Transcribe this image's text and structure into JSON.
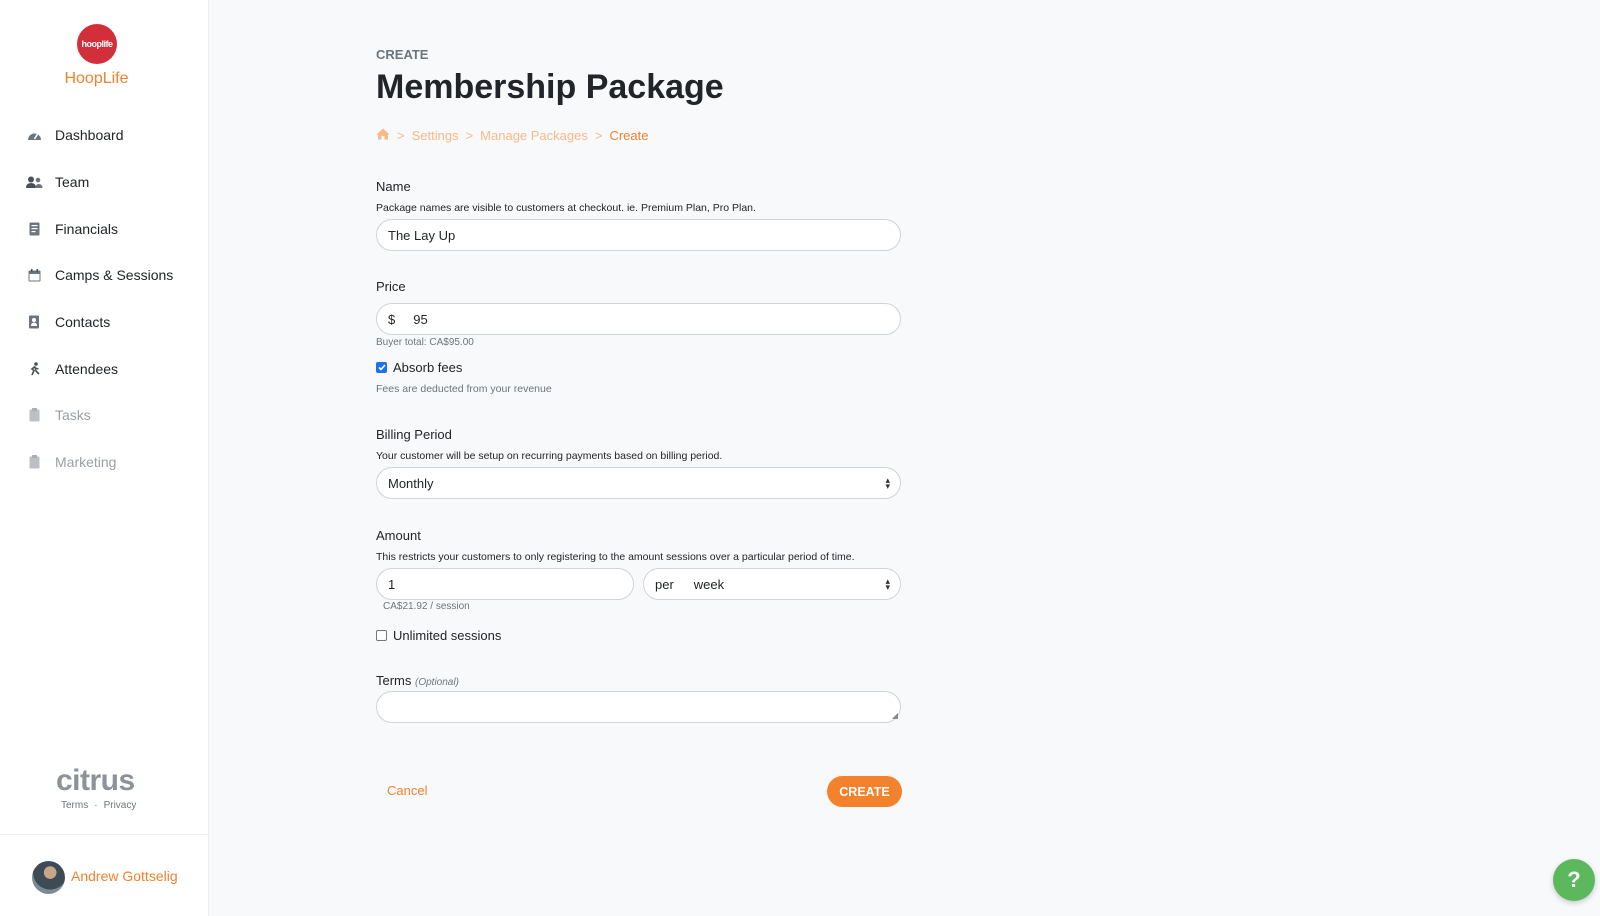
{
  "brand": {
    "logo_text": "hooplife",
    "name": "HoopLife",
    "accent": "#f4812b",
    "logo_color": "#d32f3a"
  },
  "sidebar": {
    "items": [
      {
        "label": "Dashboard",
        "icon": "gauge-icon",
        "disabled": false
      },
      {
        "label": "Team",
        "icon": "users-icon",
        "disabled": false
      },
      {
        "label": "Financials",
        "icon": "receipt-icon",
        "disabled": false
      },
      {
        "label": "Camps & Sessions",
        "icon": "calendar-icon",
        "disabled": false
      },
      {
        "label": "Contacts",
        "icon": "address-book-icon",
        "disabled": false
      },
      {
        "label": "Attendees",
        "icon": "running-icon",
        "disabled": false
      },
      {
        "label": "Tasks",
        "icon": "clipboard-icon",
        "disabled": true
      },
      {
        "label": "Marketing",
        "icon": "clipboard-icon",
        "disabled": true
      }
    ],
    "footer_logo": "citrus",
    "terms_link": "Terms",
    "separator": "·",
    "privacy_link": "Privacy",
    "user_name": "Andrew Gottselig"
  },
  "page": {
    "eyebrow": "CREATE",
    "title": "Membership Package",
    "breadcrumb": {
      "home_icon": "home-icon",
      "sep": ">",
      "items": [
        "Settings",
        "Manage Packages"
      ],
      "current": "Create"
    }
  },
  "form": {
    "name": {
      "label": "Name",
      "help": "Package names are visible to customers at checkout. ie. Premium Plan, Pro Plan.",
      "value": "The Lay Up"
    },
    "price": {
      "label": "Price",
      "prefix": "$",
      "value": "95",
      "buyer_total": "Buyer total: CA$95.00",
      "absorb_label": "Absorb fees",
      "absorb_checked": true,
      "absorb_help": "Fees are deducted from your revenue"
    },
    "billing": {
      "label": "Billing Period",
      "help": "Your customer will be setup on recurring payments based on billing period.",
      "value": "Monthly"
    },
    "amount": {
      "label": "Amount",
      "help": "This restricts your customers to only registering to the amount sessions over a particular period of time.",
      "value": "1",
      "per_label": "per",
      "period_value": "week",
      "per_session": "CA$21.92 / session",
      "unlimited_label": "Unlimited sessions",
      "unlimited_checked": false
    },
    "terms": {
      "label": "Terms",
      "optional": "(Optional)",
      "value": ""
    },
    "cancel_label": "Cancel",
    "submit_label": "CREATE"
  },
  "help_button": {
    "label": "?",
    "color": "#5cb85c"
  }
}
